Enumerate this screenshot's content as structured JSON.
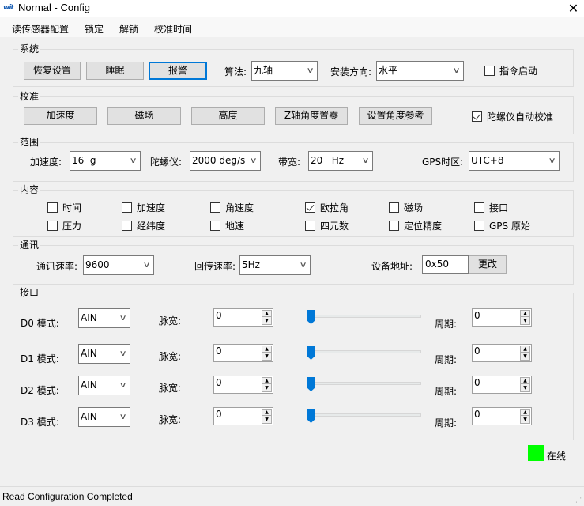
{
  "window": {
    "title": "Normal - Config",
    "app_icon": "wit-logo-icon",
    "close_glyph": "✕"
  },
  "menu": [
    "读传感器配置",
    "锁定",
    "解锁",
    "校准时间"
  ],
  "system": {
    "title": "系统",
    "buttons": [
      "恢复设置",
      "睡眠",
      "报警"
    ],
    "algorithm_label": "算法:",
    "algorithm_value": "九轴",
    "orientation_label": "安装方向:",
    "orientation_value": "水平",
    "cmd_start_label": "指令启动",
    "cmd_start_checked": false
  },
  "calibration": {
    "title": "校准",
    "buttons": [
      "加速度",
      "磁场",
      "高度",
      "Z轴角度置零",
      "设置角度参考"
    ],
    "gyro_auto_label": "陀螺仪自动校准",
    "gyro_auto_checked": true
  },
  "range": {
    "title": "范围",
    "accel_label": "加速度:",
    "accel_value": "16  g",
    "gyro_label": "陀螺仪:",
    "gyro_value": "2000 deg/s",
    "bandwidth_label": "带宽:",
    "bandwidth_value": "20   Hz",
    "gps_tz_label": "GPS时区:",
    "gps_tz_value": "UTC+8"
  },
  "content": {
    "title": "内容",
    "items": [
      {
        "label": "时间",
        "checked": false
      },
      {
        "label": "加速度",
        "checked": false
      },
      {
        "label": "角速度",
        "checked": false
      },
      {
        "label": "欧拉角",
        "checked": true
      },
      {
        "label": "磁场",
        "checked": false
      },
      {
        "label": "接口",
        "checked": false
      },
      {
        "label": "压力",
        "checked": false
      },
      {
        "label": "经纬度",
        "checked": false
      },
      {
        "label": "地速",
        "checked": false
      },
      {
        "label": "四元数",
        "checked": false
      },
      {
        "label": "定位精度",
        "checked": false
      },
      {
        "label": "GPS 原始",
        "checked": false
      }
    ]
  },
  "comm": {
    "title": "通讯",
    "baud_label": "通讯速率:",
    "baud_value": "9600",
    "rate_label": "回传速率:",
    "rate_value": "5Hz",
    "addr_label": "设备地址:",
    "addr_value": "0x50",
    "change_button": "更改"
  },
  "ports": {
    "title": "接口",
    "pulse_label": "脉宽:",
    "period_label": "周期:",
    "rows": [
      {
        "mode_label": "D0 模式:",
        "mode_value": "AIN",
        "pulse_value": "0",
        "slider_level": 0,
        "period_value": "0"
      },
      {
        "mode_label": "D1 模式:",
        "mode_value": "AIN",
        "pulse_value": "0",
        "slider_level": 0,
        "period_value": "0"
      },
      {
        "mode_label": "D2 模式:",
        "mode_value": "AIN",
        "pulse_value": "0",
        "slider_level": 0,
        "period_value": "0"
      },
      {
        "mode_label": "D3 模式:",
        "mode_value": "AIN",
        "pulse_value": "0",
        "slider_level": 0,
        "period_value": "0"
      }
    ]
  },
  "status": {
    "online_label": "在线",
    "online_color": "#00ff00",
    "message": "Read Configuration Completed"
  },
  "colors": {
    "accent": "#0078d7",
    "background": "#f0f0f0"
  }
}
